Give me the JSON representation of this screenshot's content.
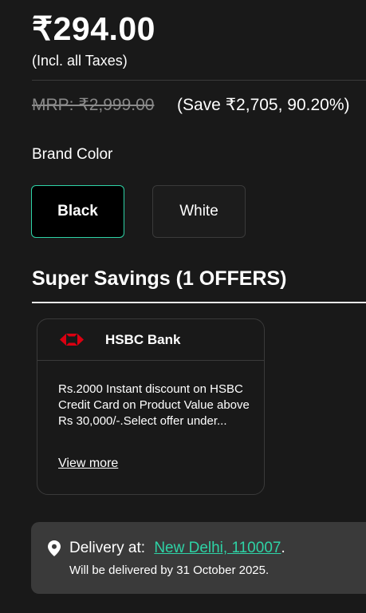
{
  "price": {
    "current": "₹294.00",
    "tax_note": "(Incl. all Taxes)",
    "mrp": "MRP: ₹2,999.00",
    "save": "(Save ₹2,705, 90.20%)"
  },
  "brand_color": {
    "label": "Brand Color",
    "options": [
      "Black",
      "White"
    ],
    "selected": "Black",
    "accent": "#2ed3a6"
  },
  "savings": {
    "title": "Super Savings (1 OFFERS)",
    "offers": [
      {
        "bank": "HSBC Bank",
        "icon": "hsbc-logo",
        "description": "Rs.2000 Instant discount on HSBC Credit Card on Product Value above Rs 30,000/-.Select offer under...",
        "link": "View more"
      }
    ]
  },
  "delivery": {
    "icon": "map-pin-icon",
    "label": "Delivery at:",
    "location": "New Delhi, 110007",
    "period": ".",
    "eta": "Will be delivered by 31 October 2025."
  }
}
